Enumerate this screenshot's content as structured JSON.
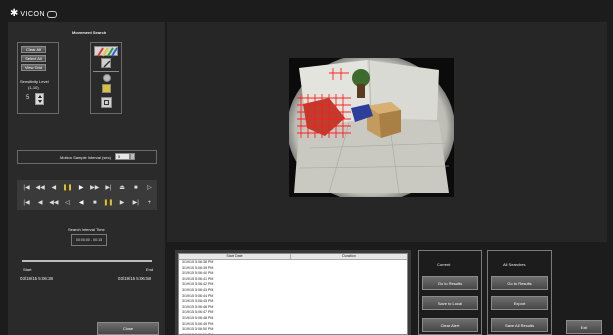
{
  "app": {
    "logo_text": "VICON"
  },
  "left": {
    "title": "Movement Search",
    "buttons": [
      "Clear All",
      "Select All",
      "View Grid"
    ],
    "sensitivity_label": "Sensitivity Level",
    "sensitivity_sub": "(1-10)",
    "sensitivity_value": "5",
    "interval_label": "Motion Sample Interval (sec)",
    "interval_value": "5"
  },
  "playback": {
    "row1": [
      "|◀",
      "◀◀",
      "◀",
      "❚❚",
      "▶",
      "▶▶",
      "▶|",
      "⏏",
      "■",
      "▷"
    ],
    "row2": [
      "|◀",
      "◀",
      "◀◀",
      "◁",
      "◀",
      "■",
      "❚❚",
      "▶",
      "▶|",
      "+"
    ]
  },
  "range": {
    "title": "Search Interval Time",
    "time_value": "00:00:00 - 00:15",
    "start_label": "Start",
    "end_label": "End",
    "start_time": "03/19/15 5:06:38",
    "end_time": "03/19/15 5:06:58"
  },
  "results": {
    "headers": [
      "Start Date",
      "Duration"
    ],
    "rows": [
      "3/19/15 5:06:38 PM",
      "3/19/15 5:06:39 PM",
      "3/19/15 5:06:40 PM",
      "3/19/15 5:06:41 PM",
      "3/19/15 5:06:42 PM",
      "3/19/15 5:06:43 PM",
      "3/19/15 5:06:44 PM",
      "3/19/15 5:06:45 PM",
      "3/19/15 5:06:46 PM",
      "3/19/15 5:06:47 PM",
      "3/19/15 5:06:48 PM",
      "3/19/15 5:06:49 PM",
      "3/19/15 5:06:50 PM",
      "3/19/15 5:06:51 PM",
      "3/19/15 5:06:52 PM",
      "3/19/15 5:06:53 PM"
    ],
    "selected_index": 15
  },
  "current": {
    "title": "Current",
    "buttons": [
      "Go to Results",
      "Save to Local",
      "Clear Alert"
    ]
  },
  "all": {
    "title": "All Searches",
    "buttons": [
      "Go to Results",
      "Export",
      "Save All Results"
    ]
  },
  "bottom": {
    "left_button": "Close",
    "exit_button": "Exit"
  }
}
